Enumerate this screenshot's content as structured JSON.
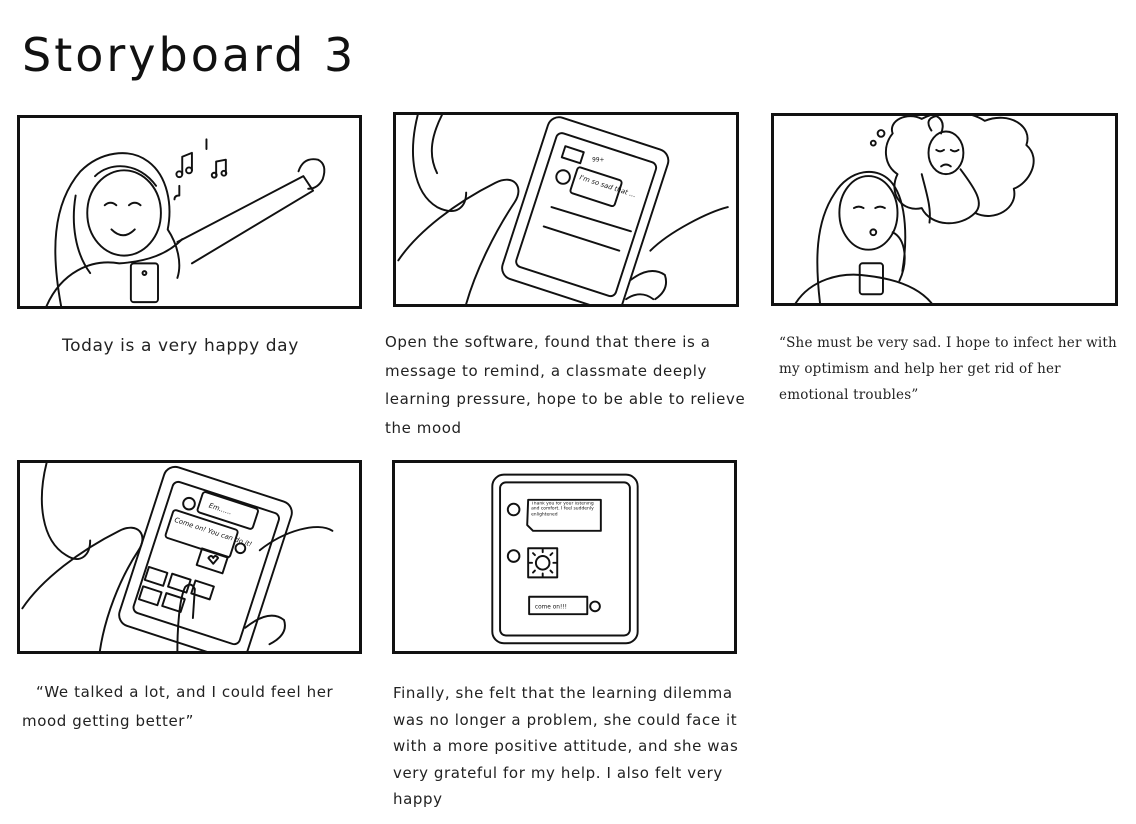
{
  "page": {
    "title": "Storyboard 3"
  },
  "panels": [
    {
      "caption": "Today is a very happy day"
    },
    {
      "caption": "Open the software, found that there is a message to remind, a classmate deeply learning pressure, hope to be able to relieve the mood",
      "phone": {
        "status": "99+",
        "bubble": "I'm so sad that ..."
      }
    },
    {
      "caption": "“She must be very sad. I hope to infect her with my optimism and help her get rid of her emotional troubles”"
    },
    {
      "caption": "“We talked a lot, and I could feel her mood getting better”",
      "phone": {
        "bubble_top": "Em......",
        "bubble_mid": "Come on! You can do it!"
      }
    },
    {
      "caption": "Finally, she felt that the learning dilemma was no longer a problem, she could face it with a more positive attitude, and she was very grateful for my help. I also felt very happy",
      "phone": {
        "bubble_top": "Thank you for your listening and comfort. I feel suddenly enlightened",
        "bubble_bottom": "come on!!!"
      }
    }
  ]
}
